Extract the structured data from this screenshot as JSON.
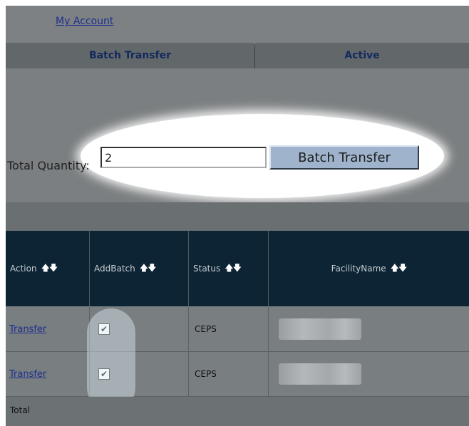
{
  "header": {
    "my_account_label": "My Account"
  },
  "tabs": [
    {
      "label": "Batch Transfer"
    },
    {
      "label": "Active"
    }
  ],
  "batch_form": {
    "quantity_label": "Total Quantity:",
    "quantity_value": "2",
    "submit_label": "Batch Transfer"
  },
  "grid": {
    "columns": [
      {
        "label": "Action",
        "sort_icon": "sort-up-down-icon"
      },
      {
        "label": "AddBatch",
        "sort_icon": "sort-up-down-icon"
      },
      {
        "label": "Status",
        "sort_icon": "sort-up-down-icon"
      },
      {
        "label": "FacilityName",
        "sort_icon": "sort-up-down-icon"
      }
    ],
    "sort_glyph": "🡅🡇",
    "rows": [
      {
        "action": "Transfer",
        "add_batch_checked": true,
        "status": "CEPS"
      },
      {
        "action": "Transfer",
        "add_batch_checked": true,
        "status": "CEPS"
      }
    ],
    "footer_label": "Total"
  },
  "colors": {
    "panel_bg": "#7a7e80",
    "header_bg": "#0c2434",
    "button_bg": "#9fb4cc",
    "link": "#1d2f8f"
  }
}
